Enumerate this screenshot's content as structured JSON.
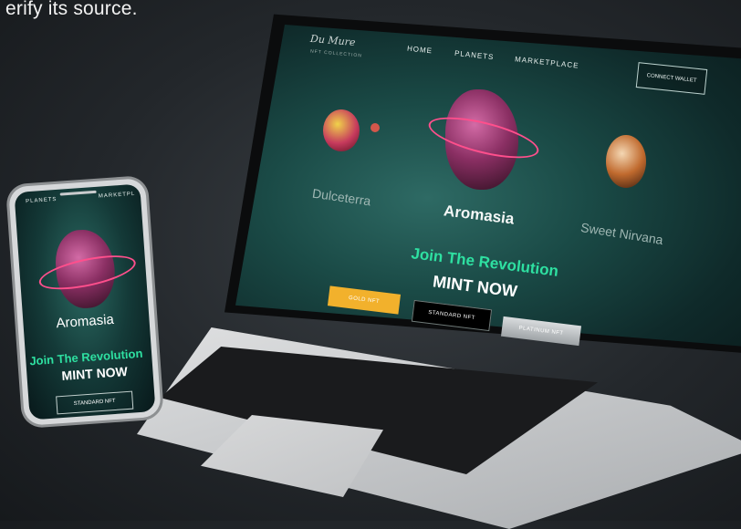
{
  "caption": "erify its source.",
  "brand": {
    "logo_text": "Du Mure",
    "logo_sub": "NFT COLLECTION"
  },
  "nav": {
    "items": [
      {
        "label": "HOME"
      },
      {
        "label": "PLANETS"
      },
      {
        "label": "MARKETPLACE"
      }
    ],
    "connect_label": "CONNECT WALLET"
  },
  "hero": {
    "left_planet": "Dulceterra",
    "center_planet": "Aromasia",
    "right_planet": "Sweet Nirvana",
    "tagline": "Join The Revolution",
    "cta": "MINT NOW"
  },
  "buttons": [
    {
      "label": "GOLD NFT",
      "color": "#f2b12c"
    },
    {
      "label": "STANDARD NFT",
      "color": "#000000"
    },
    {
      "label": "PLATINUM NFT",
      "color": "#b9bdc0"
    }
  ],
  "phone": {
    "nav_left": "PLANETS",
    "nav_right": "MARKETPL",
    "planet": "Aromasia",
    "tagline": "Join The Revolution",
    "cta": "MINT NOW",
    "button": "STANDARD NFT"
  },
  "colors": {
    "accent": "#2ee0a1",
    "gold": "#f2b12c"
  }
}
